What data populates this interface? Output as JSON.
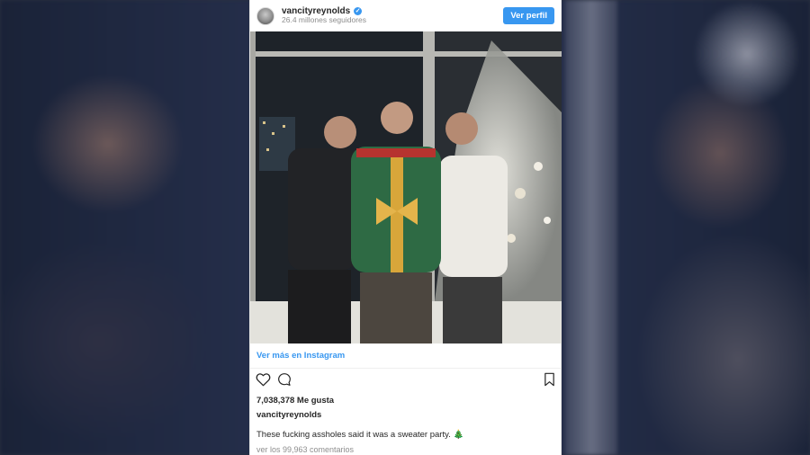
{
  "post": {
    "username": "vancityreynolds",
    "followers": "26.4 millones seguidores",
    "view_profile_label": "Ver perfil",
    "more_label": "Ver más en Instagram",
    "likes": "7,038,378 Me gusta",
    "caption_user": "vancityreynolds",
    "caption_text": "These fucking assholes said it was a sweater party.",
    "caption_emoji": "🎄",
    "comments": "ver los 99,963 comentarios"
  },
  "icons": {
    "verified": "verified-badge-icon",
    "like": "heart-icon",
    "comment": "comment-bubble-icon",
    "save": "bookmark-icon"
  },
  "colors": {
    "accent": "#3897f0",
    "text": "#262626",
    "muted": "#8e8e8e"
  }
}
